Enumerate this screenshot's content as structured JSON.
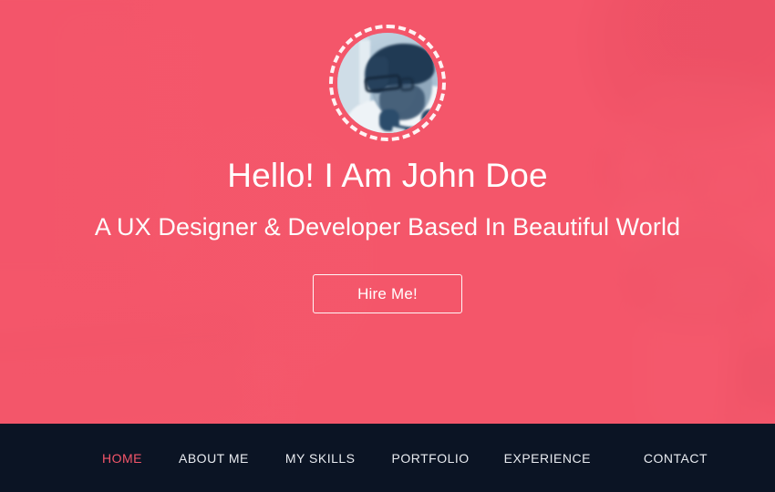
{
  "hero": {
    "avatar_alt": "profile-photo",
    "headline": "Hello! I Am John Doe",
    "subhead": "A UX Designer & Developer Based In Beautiful World",
    "cta_label": "Hire Me!"
  },
  "nav": {
    "items": [
      {
        "label": "HOME",
        "active": true
      },
      {
        "label": "ABOUT ME",
        "active": false
      },
      {
        "label": "MY SKILLS",
        "active": false
      },
      {
        "label": "PORTFOLIO",
        "active": false
      },
      {
        "label": "EXPERIENCE",
        "active": false
      },
      {
        "label": "CONTACT",
        "active": false
      }
    ]
  },
  "colors": {
    "hero_background": "#f4566a",
    "nav_background": "#0b1424",
    "accent": "#f4566a",
    "text_light": "#ffffff",
    "nav_text": "#e8ebf0"
  }
}
